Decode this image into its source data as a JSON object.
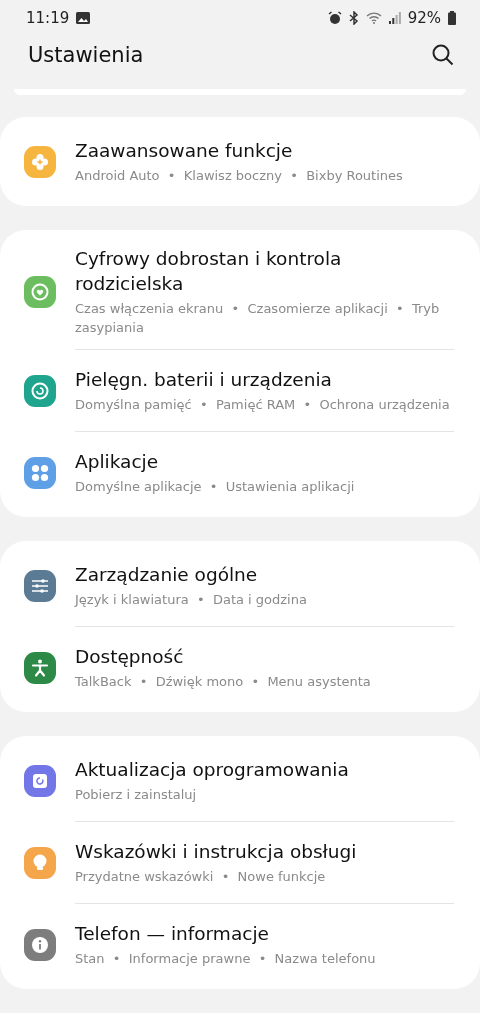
{
  "status_bar": {
    "time": "11:19",
    "battery": "92%"
  },
  "header": {
    "title": "Ustawienia"
  },
  "groups": [
    {
      "items": [
        {
          "color": "#f5b53f",
          "title": "Zaawansowane funkcje",
          "subtitle": "Android Auto  •  Klawisz boczny  •  Bixby Routines"
        }
      ]
    },
    {
      "items": [
        {
          "color": "#6bbd5f",
          "title": "Cyfrowy dobrostan i kontrola rodzicielska",
          "subtitle": "Czas włączenia ekranu  •  Czasomierze aplikacji  •  Tryb zasypiania"
        },
        {
          "color": "#1fa58d",
          "title": "Pielęgn. baterii i urządzenia",
          "subtitle": "Domyślna pamięć  •  Pamięć RAM  •  Ochrona urządzenia"
        },
        {
          "color": "#5f9fe6",
          "title": "Aplikacje",
          "subtitle": "Domyślne aplikacje  •  Ustawienia aplikacji"
        }
      ]
    },
    {
      "items": [
        {
          "color": "#5b7a94",
          "title": "Zarządzanie ogólne",
          "subtitle": "Język i klawiatura  •  Data i godzina"
        },
        {
          "color": "#2c8a46",
          "title": "Dostępność",
          "subtitle": "TalkBack  •  Dźwięk mono  •  Menu asystenta"
        }
      ]
    },
    {
      "items": [
        {
          "color": "#7276e6",
          "title": "Aktualizacja oprogramowania",
          "subtitle": "Pobierz i zainstaluj"
        },
        {
          "color": "#f5a54a",
          "title": "Wskazówki i instrukcja obsługi",
          "subtitle": "Przydatne wskazówki  •  Nowe funkcje"
        },
        {
          "color": "#7d7d7d",
          "title": "Telefon — informacje",
          "subtitle": "Stan  •  Informacje prawne  •  Nazwa telefonu"
        }
      ]
    }
  ]
}
